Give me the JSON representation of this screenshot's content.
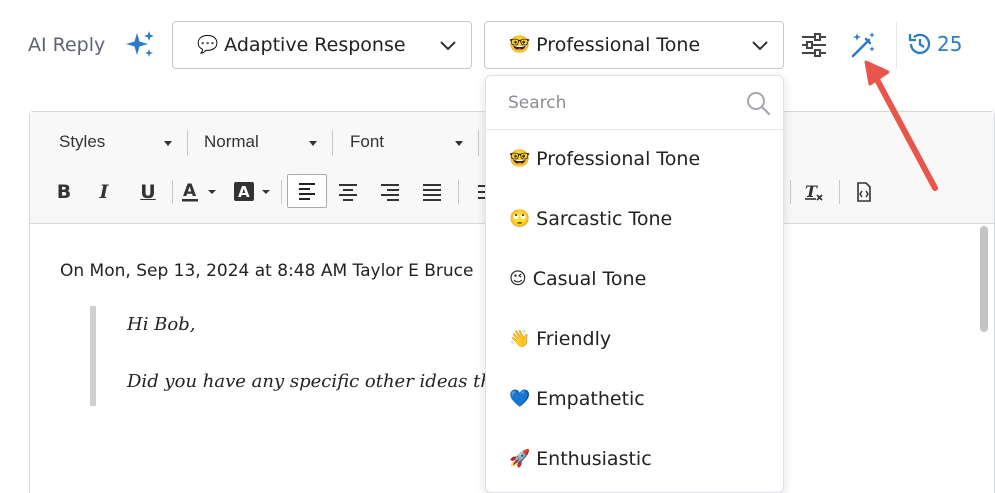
{
  "header": {
    "ai_label": "AI Reply",
    "adaptive_select": {
      "emoji": "💬",
      "label": "Adaptive Response"
    },
    "tone_select": {
      "emoji": "🤓",
      "label": "Professional Tone"
    },
    "history_count": "25"
  },
  "toolbar": {
    "styles_label": "Styles",
    "format_label": "Normal",
    "font_label": "Font"
  },
  "editor": {
    "quote_header": "On Mon, Sep 13, 2024 at 8:48 AM Taylor E Bruce",
    "quote_greeting": "Hi Bob,",
    "quote_line2": "Did you have any specific other ideas that?"
  },
  "menu": {
    "search_placeholder": "Search",
    "items": [
      {
        "emoji": "🤓",
        "label": "Professional Tone"
      },
      {
        "emoji": "🙄",
        "label": "Sarcastic Tone"
      },
      {
        "emoji": "😉",
        "label": "Casual Tone"
      },
      {
        "emoji": "👋",
        "label": "Friendly"
      },
      {
        "emoji": "💙",
        "label": "Empathetic"
      },
      {
        "emoji": "🚀",
        "label": "Enthusiastic"
      }
    ]
  },
  "colors": {
    "accent": "#2d7bc4",
    "annotation_arrow": "#e8554a"
  }
}
